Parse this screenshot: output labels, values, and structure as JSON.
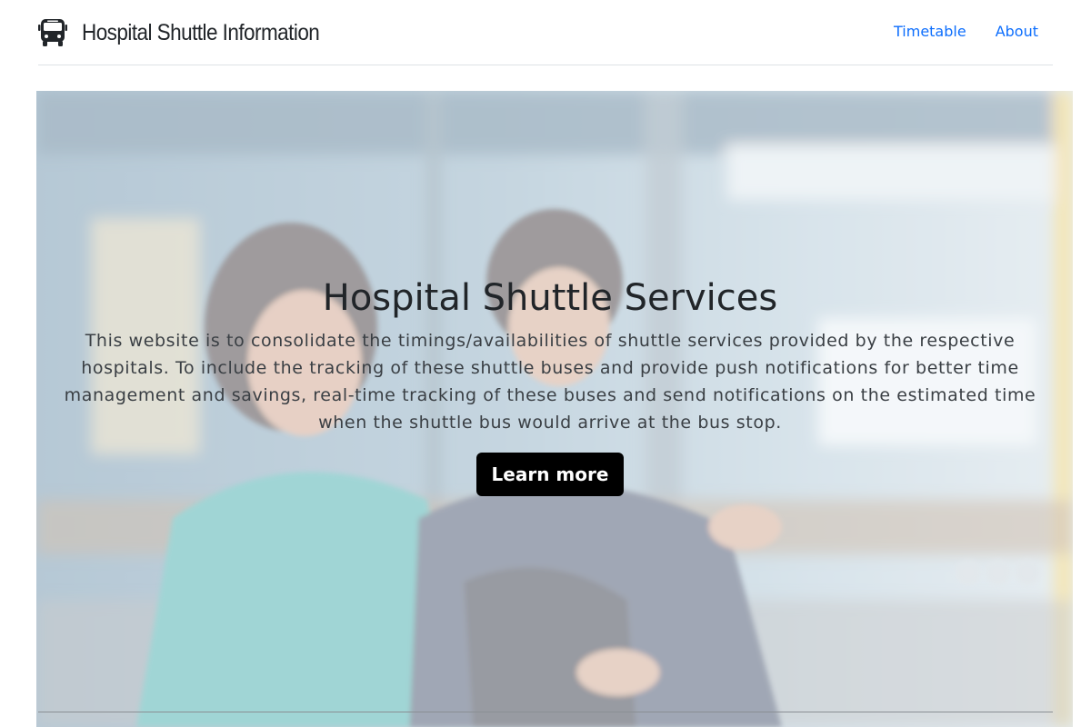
{
  "header": {
    "brand_icon": "bus-icon",
    "brand_title": "Hospital Shuttle Information",
    "nav": [
      {
        "label": "Timetable"
      },
      {
        "label": "About"
      }
    ]
  },
  "hero": {
    "background_image": "people-waiting-at-bus-stop-photo",
    "title": "Hospital Shuttle Services",
    "description": "This website is to consolidate the timings/availabilities of shuttle services provided by the respective hospitals. To include the tracking of these shuttle buses and provide push notifications for better time management and savings, real-time tracking of these buses and send notifications on the estimated time when the shuttle bus would arrive at the bus stop.",
    "cta_label": "Learn more"
  },
  "colors": {
    "link": "#0d6efd",
    "button_bg": "#000000",
    "text": "#212529"
  }
}
